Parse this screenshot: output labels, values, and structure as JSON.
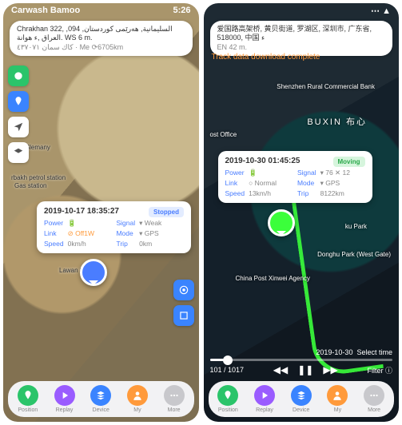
{
  "left": {
    "status": {
      "time": "5:26",
      "carrier": "Carwash Bamoo"
    },
    "address": {
      "line1": "Chrakhan 322, السليمانية, هەرێمی كوردستان, 094, العراق ,ء هوانة. WS 6 m.",
      "line2": "Me ⟳6705km",
      "tag": "كاك سمان ٤٣٧٠٧١"
    },
    "card": {
      "timestamp": "2019-10-17 18:35:27",
      "state": "Stopped",
      "rows": {
        "power_k": "Power",
        "power_v": "🔋",
        "signal_k": "Signal",
        "signal_v": "▾ Weak",
        "link_k": "Link",
        "link_v": "⊘ Off1W",
        "mode_k": "Mode",
        "mode_v": "▾ GPS",
        "speed_k": "Speed",
        "speed_v": "0km/h",
        "trip_k": "Trip",
        "trip_v": "0km"
      }
    },
    "labels": {
      "a": "pery Slemany",
      "b": "rbakh petrol station",
      "c": "Gas station",
      "d": "Lawan Shop"
    },
    "tabs": {
      "position": "Position",
      "replay": "Replay",
      "device": "Device",
      "my": "My",
      "more": "More"
    }
  },
  "right": {
    "status": {
      "time": " ",
      "icons": "⋯ ▲"
    },
    "address": {
      "line1": "爱国路高架桥, 黄贝街道, 罗湖区, 深圳市, 广东省, 518000, 中国 ء",
      "line2": "EN 42 m."
    },
    "banner": "Track data download complete",
    "card": {
      "timestamp": "2019-10-30 01:45:25",
      "state": "Moving",
      "rows": {
        "power_k": "Power",
        "power_v": "🔋",
        "signal_k": "Signal",
        "signal_v": "▾ 76  ✕ 12",
        "link_k": "Link",
        "link_v": "○ Normal",
        "mode_k": "Mode",
        "mode_v": "▾ GPS",
        "speed_k": "Speed",
        "speed_v": "13km/h",
        "trip_k": "Trip",
        "trip_v": "8122km"
      }
    },
    "labels": {
      "a": "BUXIN 布心",
      "b": "Shenzhen Rural Commercial Bank",
      "c": "ost Office",
      "d": "ku Park",
      "e": "Donghu Park (West Gate)",
      "f": "China Post Xinwei Agency"
    },
    "timebar": {
      "date": "2019-10-30",
      "hint": "Select time",
      "count": "101 / 1017",
      "filter": "Filter ⓘ"
    },
    "tabs": {
      "position": "Position",
      "replay": "Replay",
      "device": "Device",
      "my": "My",
      "more": "More"
    }
  }
}
